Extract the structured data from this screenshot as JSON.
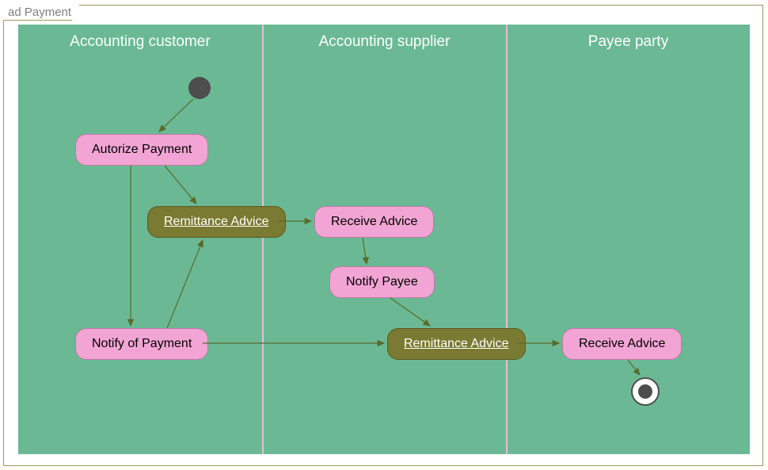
{
  "frame": {
    "title": "ad Payment"
  },
  "lanes": {
    "customer": "Accounting customer",
    "supplier": "Accounting supplier",
    "payee": "Payee party"
  },
  "nodes": {
    "authorize": "Autorize Payment",
    "remittance1": "Remittance Advice",
    "receive1": "Receive Advice",
    "notifyPayee": "Notify Payee",
    "notifyPayment": "Notify of Payment",
    "remittance2": "Remittance Advice",
    "receive2": "Receive Advice"
  },
  "chart_data": {
    "type": "activity-diagram",
    "title": "ad Payment",
    "swimlanes": [
      "Accounting customer",
      "Accounting supplier",
      "Payee party"
    ],
    "nodes": [
      {
        "id": "initial",
        "type": "initial",
        "lane": "Accounting customer"
      },
      {
        "id": "authorize",
        "type": "activity",
        "label": "Autorize Payment",
        "lane": "Accounting customer"
      },
      {
        "id": "remittance1",
        "type": "object",
        "label": "Remittance Advice",
        "lane": "Accounting customer"
      },
      {
        "id": "notifyPayment",
        "type": "activity",
        "label": "Notify of Payment",
        "lane": "Accounting customer"
      },
      {
        "id": "receive1",
        "type": "activity",
        "label": "Receive Advice",
        "lane": "Accounting supplier"
      },
      {
        "id": "notifyPayee",
        "type": "activity",
        "label": "Notify Payee",
        "lane": "Accounting supplier"
      },
      {
        "id": "remittance2",
        "type": "object",
        "label": "Remittance Advice",
        "lane": "Accounting supplier"
      },
      {
        "id": "receive2",
        "type": "activity",
        "label": "Receive Advice",
        "lane": "Payee party"
      },
      {
        "id": "final",
        "type": "final",
        "lane": "Payee party"
      }
    ],
    "edges": [
      {
        "from": "initial",
        "to": "authorize"
      },
      {
        "from": "authorize",
        "to": "remittance1"
      },
      {
        "from": "authorize",
        "to": "notifyPayment"
      },
      {
        "from": "notifyPayment",
        "to": "remittance1"
      },
      {
        "from": "remittance1",
        "to": "receive1"
      },
      {
        "from": "receive1",
        "to": "notifyPayee"
      },
      {
        "from": "notifyPayee",
        "to": "remittance2"
      },
      {
        "from": "notifyPayment",
        "to": "remittance2"
      },
      {
        "from": "remittance2",
        "to": "receive2"
      },
      {
        "from": "receive2",
        "to": "final"
      }
    ]
  }
}
